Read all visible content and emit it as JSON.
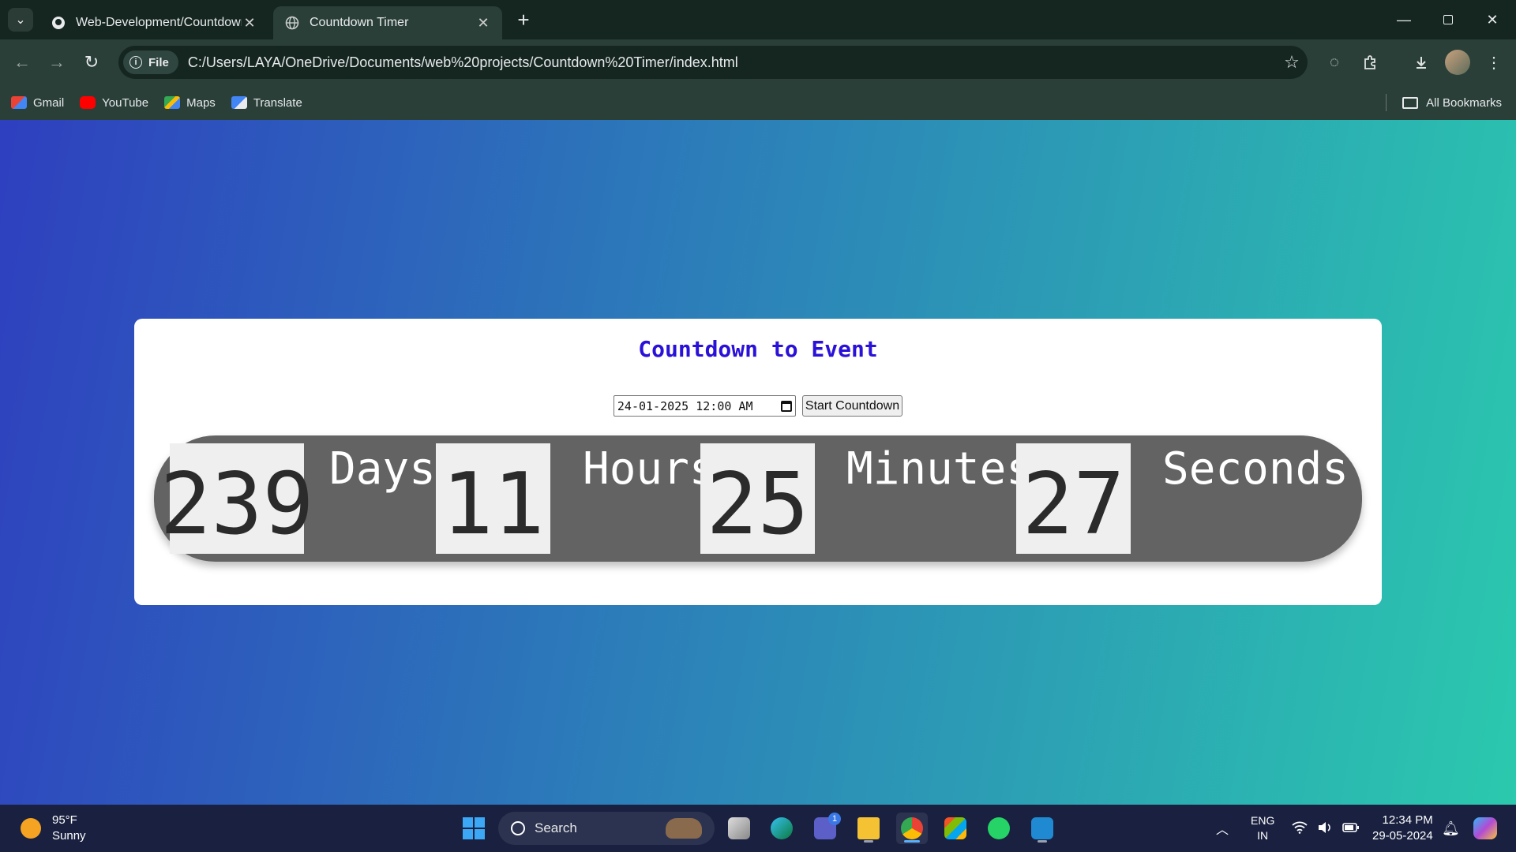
{
  "browser": {
    "tabs": [
      {
        "label": "Web-Development/Countdown",
        "icon": "github-icon",
        "active": false
      },
      {
        "label": "Countdown Timer",
        "icon": "globe-icon",
        "active": true
      }
    ],
    "new_tab_symbol": "+",
    "close_symbol": "✕",
    "file_chip_label": "File",
    "url": "C:/Users/LAYA/OneDrive/Documents/web%20projects/Countdown%20Timer/index.html",
    "bookmarks": [
      {
        "label": "Gmail",
        "icon": "gmail-icon",
        "color": "#ea4335"
      },
      {
        "label": "YouTube",
        "icon": "youtube-icon",
        "color": "#ff0000"
      },
      {
        "label": "Maps",
        "icon": "maps-icon",
        "color": "#34a853"
      },
      {
        "label": "Translate",
        "icon": "translate-icon",
        "color": "#4285f4"
      }
    ],
    "all_bookmarks_label": "All Bookmarks"
  },
  "page": {
    "title": "Countdown to Event",
    "date_input_value": "24-01-2025 12:00 AM",
    "start_button_label": "Start Countdown",
    "countdown": [
      {
        "value": "239",
        "unit": "Days"
      },
      {
        "value": "11",
        "unit": "Hours"
      },
      {
        "value": "25",
        "unit": "Minutes"
      },
      {
        "value": "27",
        "unit": "Seconds"
      }
    ],
    "colors": {
      "title": "#2a11d8",
      "timer_bar": "#636363",
      "gradient_start": "#2e3fbf",
      "gradient_end": "#2bc9ae"
    }
  },
  "taskbar": {
    "weather_temp": "95°F",
    "weather_desc": "Sunny",
    "search_placeholder": "Search",
    "teams_badge": "1",
    "language_line1": "ENG",
    "language_line2": "IN",
    "time": "12:34 PM",
    "date": "29-05-2024"
  }
}
